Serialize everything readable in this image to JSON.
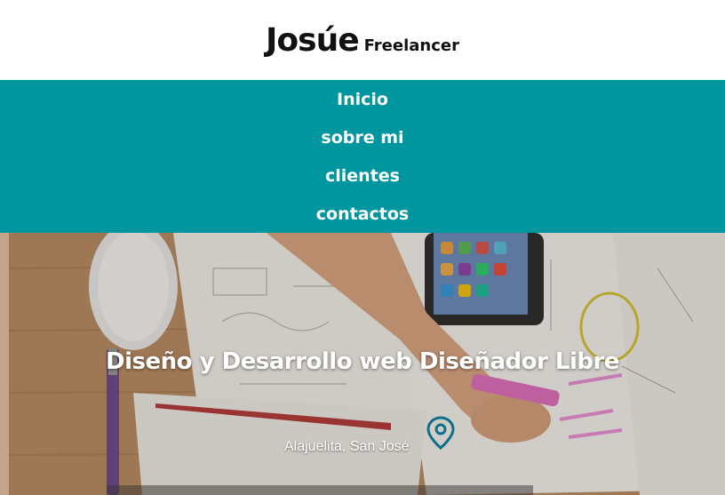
{
  "header": {
    "brand_name": "Josúe",
    "brand_tagline": "Freelancer"
  },
  "nav": {
    "items": [
      {
        "label": "Inicio"
      },
      {
        "label": "sobre mi"
      },
      {
        "label": "clientes"
      },
      {
        "label": "contactos"
      }
    ]
  },
  "hero": {
    "title": "Diseño y Desarrollo web Diseñador Libre",
    "location": "Alajuelita, San José",
    "location_icon": "map-pin-icon",
    "background_image": "desk-workspace-photo"
  },
  "colors": {
    "nav_background": "#00969f",
    "header_background": "#ffffff",
    "location_icon": "#0d6f8a"
  }
}
